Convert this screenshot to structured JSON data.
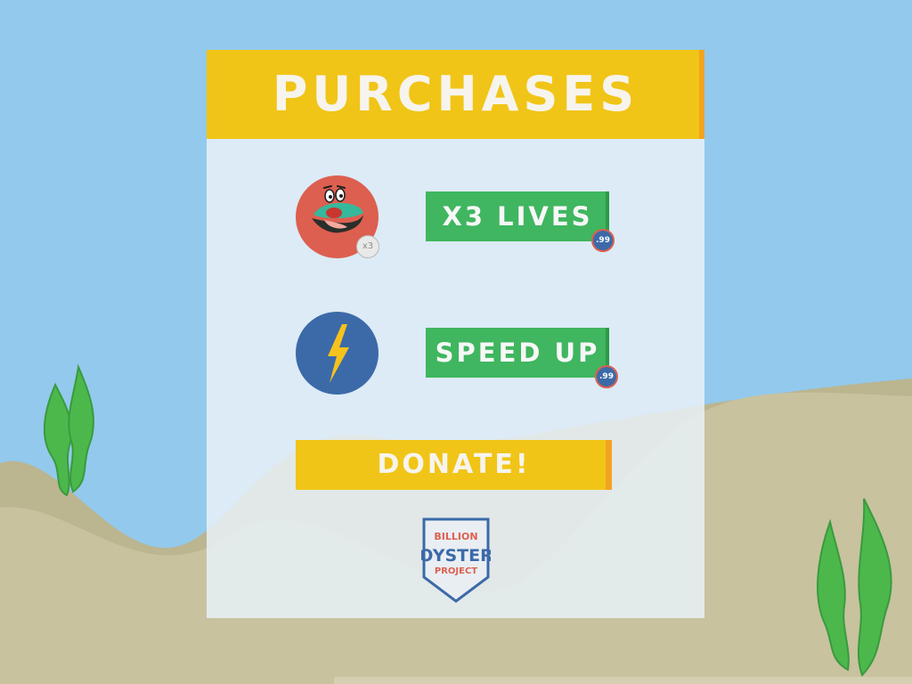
{
  "panel": {
    "title": "PURCHASES"
  },
  "items": [
    {
      "id": "lives",
      "label": "X3 LIVES",
      "price": ".99",
      "badge": "x3",
      "icon": "oyster-character-icon"
    },
    {
      "id": "speed",
      "label": "SPEED UP",
      "price": ".99",
      "icon": "lightning-bolt-icon"
    }
  ],
  "donate": {
    "label": "DONATE!"
  },
  "logo": {
    "lines": [
      "BILLION",
      "OYSTER",
      "PROJECT"
    ]
  },
  "colors": {
    "sky": "#93c9ec",
    "sand_back": "#bbb590",
    "sand_front": "#c8c29f",
    "title_bar": "#f0c517",
    "title_bar_edge": "#f2a320",
    "buy_button": "#3fb65f",
    "lives_icon_bg": "#dd5f4f",
    "speed_icon_bg": "#3c6aa8",
    "seaweed": "#4cb84c"
  }
}
